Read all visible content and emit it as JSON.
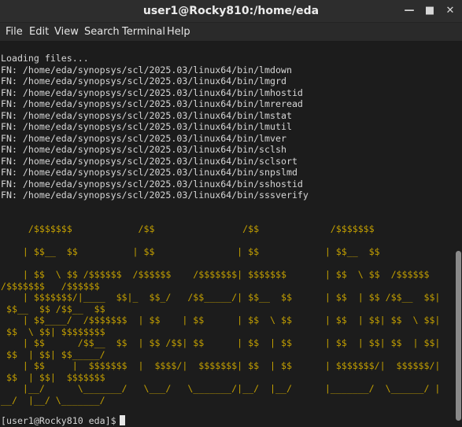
{
  "window": {
    "title": "user1@Rocky810:/home/eda",
    "minimize_icon": "minimize-icon",
    "maximize_icon": "maximize-icon",
    "close_icon": "close-icon"
  },
  "menu": [
    "File",
    "Edit",
    "View",
    "Search",
    "Terminal",
    "Help"
  ],
  "terminal": {
    "output": [
      "Loading files...",
      "FN: /home/eda/synopsys/scl/2025.03/linux64/bin/lmdown",
      "FN: /home/eda/synopsys/scl/2025.03/linux64/bin/lmgrd",
      "FN: /home/eda/synopsys/scl/2025.03/linux64/bin/lmhostid",
      "FN: /home/eda/synopsys/scl/2025.03/linux64/bin/lmreread",
      "FN: /home/eda/synopsys/scl/2025.03/linux64/bin/lmstat",
      "FN: /home/eda/synopsys/scl/2025.03/linux64/bin/lmutil",
      "FN: /home/eda/synopsys/scl/2025.03/linux64/bin/lmver",
      "FN: /home/eda/synopsys/scl/2025.03/linux64/bin/sclsh",
      "FN: /home/eda/synopsys/scl/2025.03/linux64/bin/sclsort",
      "FN: /home/eda/synopsys/scl/2025.03/linux64/bin/snpslmd",
      "FN: /home/eda/synopsys/scl/2025.03/linux64/bin/sshostid",
      "FN: /home/eda/synopsys/scl/2025.03/linux64/bin/sssverify"
    ],
    "banner": [
      "     /$$$$$$$            /$$                /$$             /$$$$$$$",
      "    | $$__  $$          | $$               | $$            | $$__  $$",
      "    | $$  \\ $$ /$$$$$$  /$$$$$$    /$$$$$$$| $$$$$$$       | $$  \\ $$  /$$$$$$",
      "/$$$$$$$   /$$$$$$",
      "    | $$$$$$$/|____  $$|_  $$_/   /$$_____/| $$__  $$      | $$  | $$ /$$__  $$|",
      " $$__  $$ /$$__  $$",
      "    | $$____/  /$$$$$$$  | $$    | $$      | $$  \\ $$      | $$  | $$| $$  \\ $$|",
      " $$  \\ $$| $$$$$$$$",
      "    | $$      /$$__  $$  | $$ /$$| $$      | $$  | $$      | $$  | $$| $$  | $$|",
      " $$  | $$| $$_____/",
      "    | $$     |  $$$$$$$  |  $$$$/|  $$$$$$$| $$  | $$      | $$$$$$$/|  $$$$$$/|",
      " $$  | $$|  $$$$$$$",
      "    |__/      \\_______/   \\___/   \\_______/|__/  |__/      |_______/  \\______/ |",
      "__/  |__/ \\_______/"
    ],
    "prompt": "[user1@Rocky810 eda]$"
  },
  "colors": {
    "background": "#1c1c1c",
    "text": "#d6d6d6",
    "banner": "#c4a000",
    "titlebar": "#2d2d2d",
    "scrollbar_thumb": "#8a8a8a"
  }
}
